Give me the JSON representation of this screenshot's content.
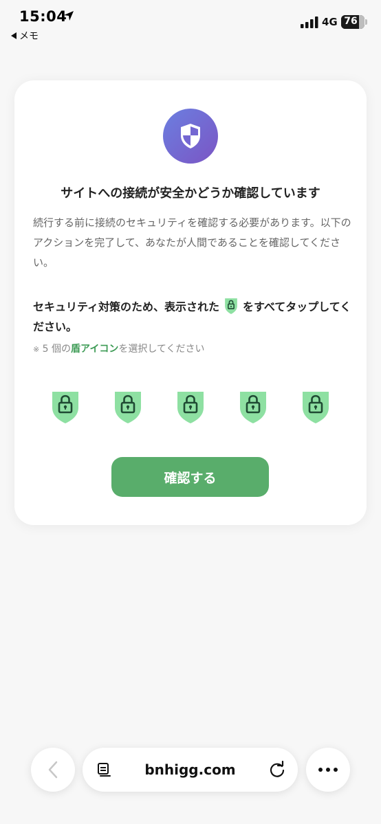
{
  "status_bar": {
    "time": "15:04",
    "back_app": "メモ",
    "network": "4G",
    "battery": "76",
    "battery_level": 0.76
  },
  "card": {
    "icon": "shield-icon",
    "title": "サイトへの接続が安全かどうか確認しています",
    "description": "続行する前に接続のセキュリティを確認する必要があります。以下のアクションを完了して、あなたが人間であることを確認してください。",
    "instruction_before": "セキュリティ対策のため、表示された",
    "instruction_after": "をすべてタップしてください。",
    "note_mark": "※",
    "note_before": "5 個の",
    "note_highlight": "盾アイコン",
    "note_after": "を選択してください",
    "shield_icons": [
      "shield-lock-icon",
      "shield-lock-icon",
      "shield-lock-icon",
      "shield-lock-icon",
      "shield-lock-icon"
    ],
    "confirm_label": "確認する"
  },
  "toolbar": {
    "address": "bnhigg.com"
  },
  "colors": {
    "accent_green": "#59ad6b",
    "shield_green": "#8ee0a2",
    "badge_start": "#6b7fe0",
    "badge_end": "#7b55c4"
  }
}
